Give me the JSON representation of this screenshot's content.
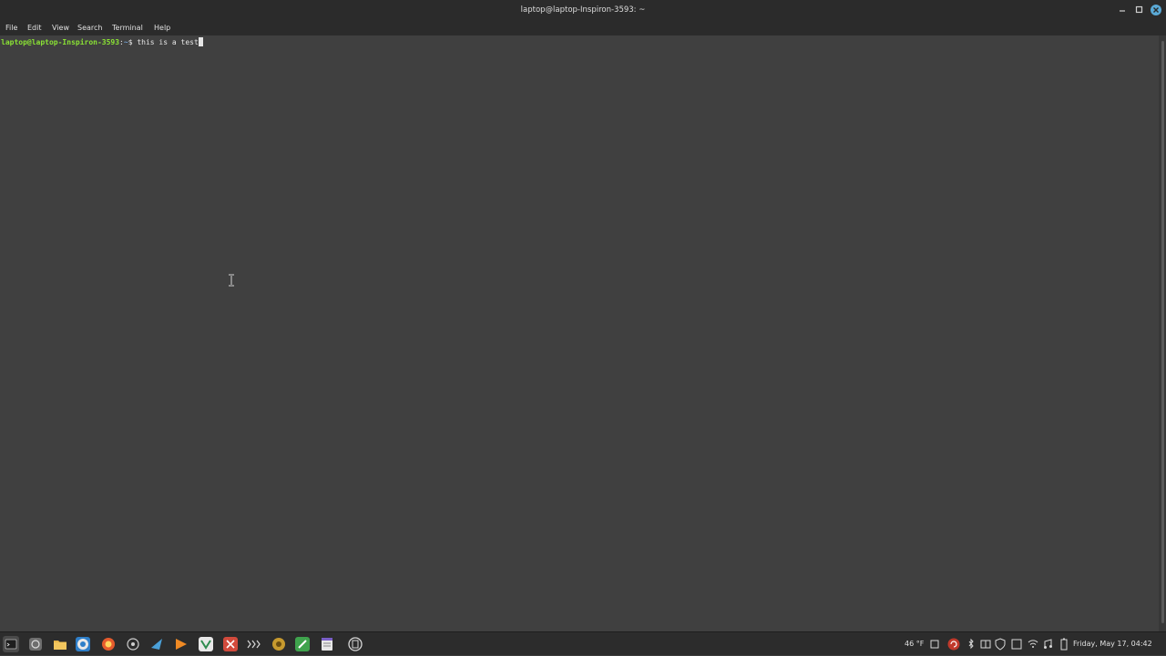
{
  "window": {
    "title": "laptop@laptop-Inspiron-3593: ~"
  },
  "menubar": {
    "items": [
      "File",
      "Edit",
      "View",
      "Search",
      "Terminal",
      "Help"
    ]
  },
  "terminal": {
    "prompt_user_host": "laptop@laptop-Inspiron-3593",
    "prompt_sep": ":",
    "prompt_path": "~",
    "prompt_symbol": "$ ",
    "command": "this is a test"
  },
  "taskbar": {
    "launchers": [
      "menu-icon",
      "show-desktop-icon",
      "files-icon",
      "chrome-icon",
      "firefox-icon",
      "settings-icon",
      "steam-icon",
      "media-player-icon",
      "vpn-icon",
      "tools-icon",
      "terminal-icon",
      "package-icon",
      "editor-icon",
      "text-editor-icon",
      "power-icon"
    ],
    "weather": "46 °F",
    "clock": "Friday, May 17, 04:42"
  },
  "colors": {
    "terminal_bg": "#404040",
    "prompt_user": "#8ae234",
    "prompt_path": "#729fcf"
  }
}
